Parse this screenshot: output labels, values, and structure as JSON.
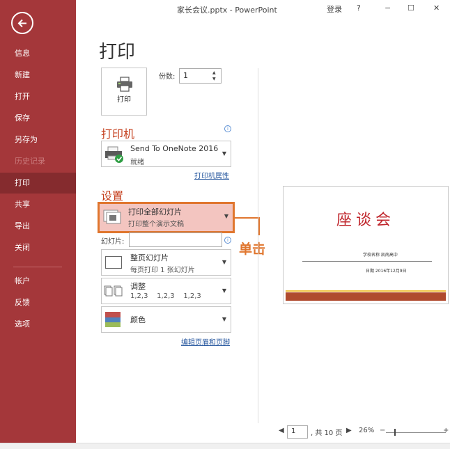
{
  "window": {
    "title": "家长会议.pptx - PowerPoint",
    "controls": {
      "signin": "登录",
      "help": "?",
      "minimize": "−",
      "restore": "☐",
      "close": "✕"
    }
  },
  "sidebar": {
    "items": [
      {
        "label": "信息"
      },
      {
        "label": "新建"
      },
      {
        "label": "打开"
      },
      {
        "label": "保存"
      },
      {
        "label": "另存为"
      },
      {
        "label": "历史记录",
        "disabled": true
      },
      {
        "label": "打印",
        "active": true
      },
      {
        "label": "共享"
      },
      {
        "label": "导出"
      },
      {
        "label": "关闭"
      },
      {
        "label": "帐户"
      },
      {
        "label": "反馈"
      },
      {
        "label": "选项"
      }
    ]
  },
  "page": {
    "title": "打印"
  },
  "print": {
    "button_label": "打印",
    "copies_label": "份数:",
    "copies_value": "1"
  },
  "printer": {
    "heading": "打印机",
    "name": "Send To OneNote 2016",
    "status": "就绪",
    "properties_link": "打印机属性"
  },
  "settings": {
    "heading": "设置",
    "range": {
      "main": "打印全部幻灯片",
      "sub": "打印整个演示文稿"
    },
    "slides_label": "幻灯片:",
    "layout": {
      "main": "整页幻灯片",
      "sub": "每页打印 1 张幻灯片"
    },
    "collate": {
      "main": "调整",
      "sub": "1,2,3    1,2,3    1,2,3"
    },
    "color": {
      "main": "颜色"
    },
    "edit_link": "编辑页眉和页脚"
  },
  "callout": {
    "text": "单击",
    "color": "#e0762e"
  },
  "preview": {
    "title": "座谈会",
    "line1": "学校名称  凯南高中",
    "line2": "日期  2016年12月9日"
  },
  "footer": {
    "prev": "◀",
    "page": "1",
    "of": ", 共 10 页",
    "next": "▶",
    "zoom": "26%",
    "zoom_out": "−",
    "zoom_in": "+"
  },
  "colors": {
    "accent": "#a4373a",
    "heading": "#c43e1c"
  }
}
